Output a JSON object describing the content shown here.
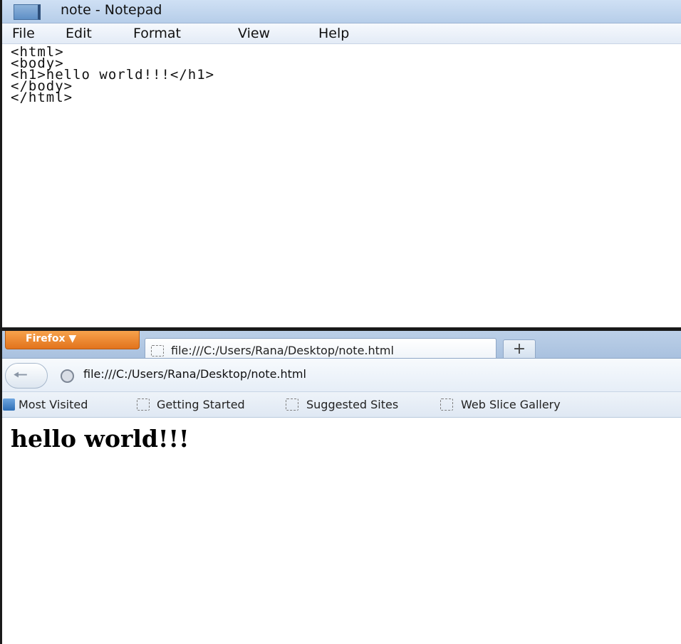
{
  "notepad": {
    "title": "note - Notepad",
    "menu": [
      "File",
      "Edit",
      "Format",
      "View",
      "Help"
    ],
    "content": "<html>\n<body>\n<h1>hello world!!!</h1>\n</body>\n</html>"
  },
  "firefox": {
    "app_button_label": "Firefox ▼",
    "tab_title": "file:///C:/Users/Rana/Desktop/note.html",
    "new_tab_label": "+",
    "url": "file:///C:/Users/Rana/Desktop/note.html",
    "bookmarks": [
      "Most Visited",
      "Getting Started",
      "Suggested Sites",
      "Web Slice Gallery"
    ],
    "page_heading": "hello world!!!"
  },
  "icons": {
    "notepad_app": "notepad-icon",
    "back": "back-arrow-icon",
    "site_identity": "globe-icon",
    "blank_page": "blank-page-icon",
    "bookmarks_menu": "bookmarks-icon"
  },
  "colors": {
    "titlebar": "#cfe0f4",
    "firefox_button": "#e2731c",
    "tabstrip": "#bcd0e8"
  }
}
